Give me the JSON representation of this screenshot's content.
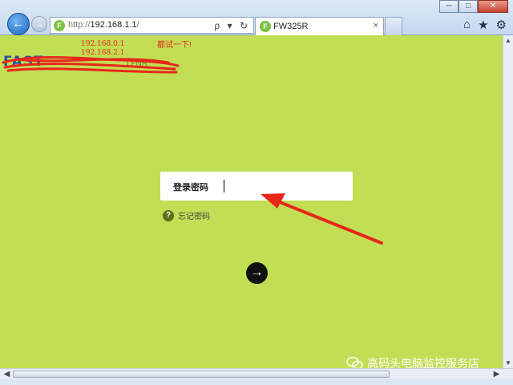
{
  "window": {
    "minimize": "─",
    "maximize": "□",
    "close": "✕"
  },
  "nav": {
    "back_icon": "back-arrow-icon",
    "forward_icon": "forward-arrow-icon"
  },
  "address_bar": {
    "favicon": "F",
    "protocol": "http://",
    "host": "192.168.1.1",
    "path": "/",
    "tools": "ρ ▾ ↻"
  },
  "tab": {
    "favicon": "F",
    "title": "FW325R",
    "close": "×"
  },
  "command_icons": {
    "home": "⌂",
    "favorites": "★",
    "tools": "⚙"
  },
  "page": {
    "ip_hints": [
      "192.168.0.1",
      "192.168.2.1"
    ],
    "try_hint": "都试一下!",
    "logo_text": "FAST",
    "logo_right_text": "|  FNR",
    "login": {
      "label": "登录密码",
      "password_value": "",
      "submit_icon": "→"
    },
    "forgot_password": {
      "icon": "?",
      "label": "忘记密码"
    },
    "watermark": "高码头电脑监控服务店"
  },
  "colors": {
    "page_bg": "#c1de55",
    "annotation": "#e8271a"
  }
}
